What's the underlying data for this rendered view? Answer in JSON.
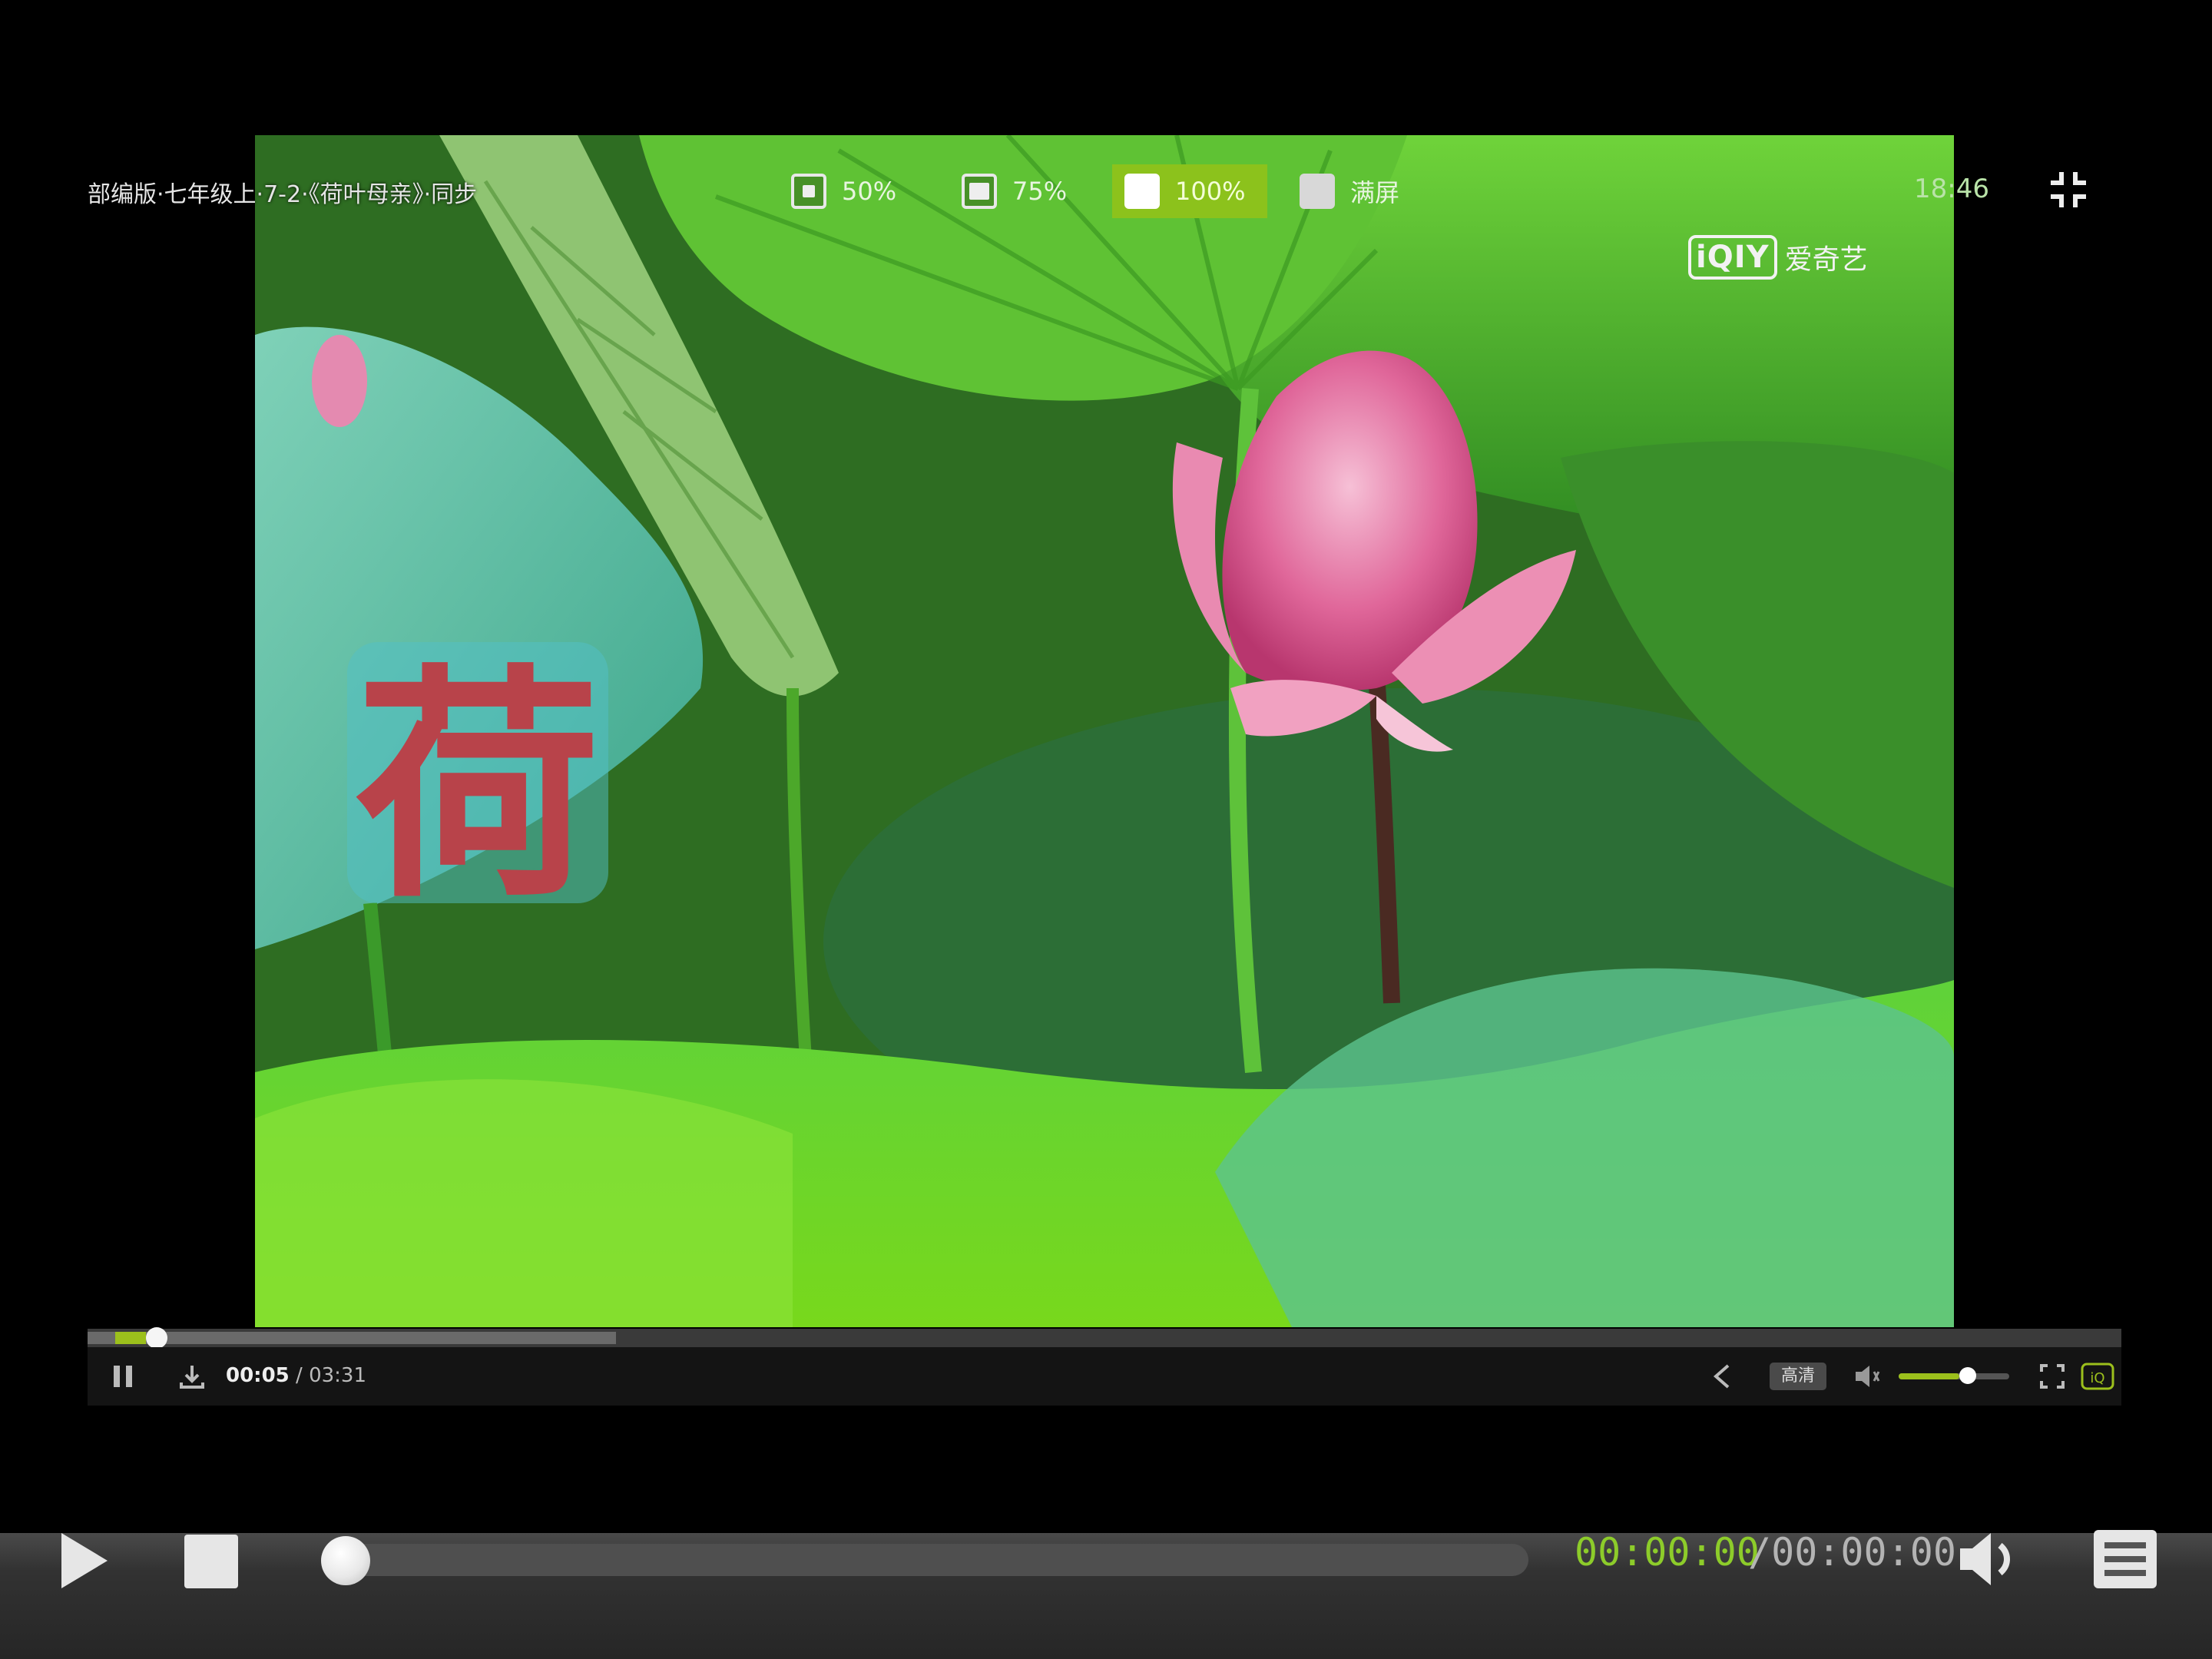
{
  "video": {
    "title": "部编版·七年级上·7-2·《荷叶母亲》·同步",
    "watermark_char": "荷",
    "brand_mark": "iQIY",
    "brand_name": "爱奇艺"
  },
  "ratio_options": [
    {
      "label": "50%",
      "active": false
    },
    {
      "label": "75%",
      "active": false
    },
    {
      "label": "100%",
      "active": true
    },
    {
      "label": "满屏",
      "active": false
    }
  ],
  "clock": "18:46",
  "inner_player": {
    "current_time": "00:05",
    "total_time": "03:31",
    "quality": "高清",
    "progress_fraction": 0.015,
    "buffered_fraction": 0.26,
    "volume_fraction": 0.55,
    "accent_color": "#9cc01c",
    "icons": [
      "pause-icon",
      "download-icon",
      "share-icon",
      "volume-icon",
      "fullscreen-icon",
      "iqiyi-logo-icon"
    ]
  },
  "outer_player": {
    "current_time": "00:00:00",
    "total_time": "/00:00:00",
    "progress_fraction": 0.0,
    "time_color": "#8dcc2a",
    "icons": [
      "play-icon",
      "stop-icon",
      "volume-icon",
      "playlist-icon"
    ]
  }
}
